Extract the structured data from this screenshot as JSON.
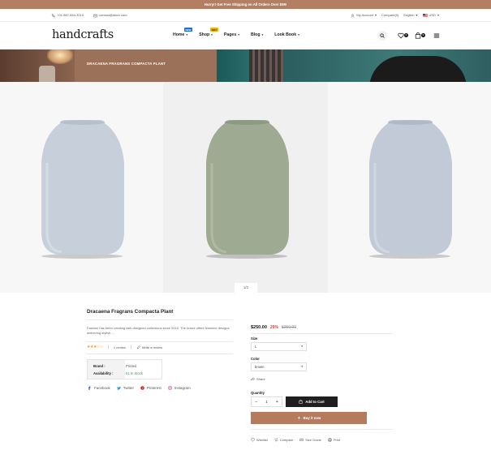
{
  "promo": {
    "text": "Hurry!! Get Free Shipping on All Orders Over $99!"
  },
  "topbar": {
    "phone": "+01-987-654-3210",
    "email": "contact@store.com",
    "account": "My Account",
    "compare": "Compare(0)",
    "language": "English",
    "currency": "USD"
  },
  "header": {
    "logo": "handcrafts",
    "nav": [
      {
        "label": "Home",
        "badge": "NEW"
      },
      {
        "label": "Shop",
        "badge": "HOT"
      },
      {
        "label": "Pages",
        "badge": ""
      },
      {
        "label": "Blog",
        "badge": ""
      },
      {
        "label": "Look Book",
        "badge": ""
      }
    ],
    "wishlist_count": "0",
    "cart_count": "0"
  },
  "banner": {
    "title": "DRACAENA FRAGRANS COMPACTA PLANT"
  },
  "gallery": {
    "pager": "1/2",
    "vases": [
      {
        "color": "#c7d0da"
      },
      {
        "color": "#9faa93"
      },
      {
        "color": "#c1cad6"
      }
    ]
  },
  "product": {
    "title": "Dracaena Fragrans Compacta Plant",
    "description": "Fashion has been creating well-designed collections since 2010. The brand offers feminine designs delivering stylish ...",
    "rating_stars": "★★★☆☆",
    "review_count": "1 review",
    "write_review": "Write a review",
    "brand_label": "Brand :",
    "brand_value": "Printed",
    "availability_label": "Availability :",
    "availability_value": "51 In Stock",
    "social": [
      "Facebook",
      "Twitter",
      "Pinterest",
      "Instagram"
    ],
    "price": "$250.00",
    "discount": "29%",
    "old_price": "$350.00",
    "size_label": "Size",
    "size_value": "L",
    "color_label": "Color",
    "color_value": "brown",
    "share": "Share",
    "quantity_label": "Quantity",
    "quantity": "1",
    "qty_minus": "−",
    "qty_plus": "+",
    "add_to_cart": "Add to Cart",
    "buy_now": "Buy it now",
    "actions": [
      "Wishlist",
      "Compare",
      "Size Guide",
      "Print"
    ]
  },
  "colors": {
    "accent": "#b67b5e",
    "promo_bg": "#b47e62",
    "dark": "#1f1f1f",
    "stock_green": "#36a05a",
    "discount_red": "#e53935"
  }
}
